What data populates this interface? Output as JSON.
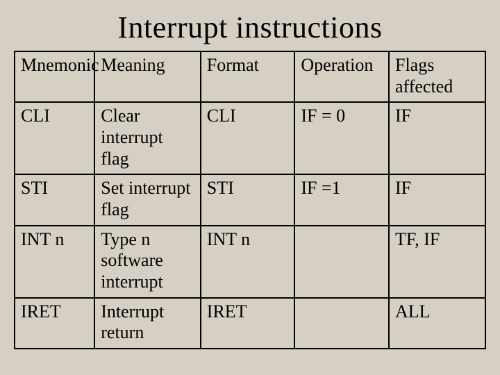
{
  "title": "Interrupt instructions",
  "headers": {
    "mnemonic": "Mnemonic",
    "meaning": "Meaning",
    "format": "Format",
    "operation": "Operation",
    "flags": "Flags affected"
  },
  "rows": [
    {
      "mnemonic": "CLI",
      "meaning": "Clear interrupt flag",
      "format": "CLI",
      "operation": "IF = 0",
      "flags": "IF"
    },
    {
      "mnemonic": "STI",
      "meaning": "Set interrupt flag",
      "format": "STI",
      "operation": "IF =1",
      "flags": "IF"
    },
    {
      "mnemonic": "INT n",
      "meaning": "Type n software interrupt",
      "format": "INT n",
      "operation": "",
      "flags": "TF, IF"
    },
    {
      "mnemonic": "IRET",
      "meaning": "Interrupt return",
      "format": "IRET",
      "operation": "",
      "flags": "ALL"
    }
  ]
}
